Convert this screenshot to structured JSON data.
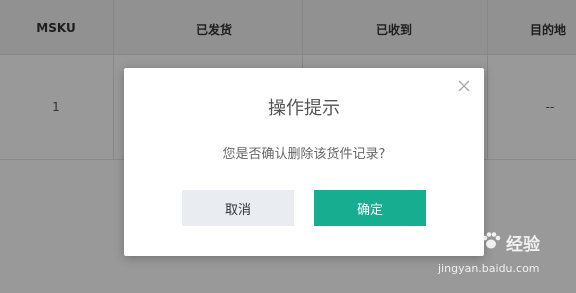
{
  "table": {
    "headers": [
      "MSKU",
      "已发货",
      "已收到",
      "目的地"
    ],
    "row": {
      "msku": "1",
      "destination": "--"
    }
  },
  "dialog": {
    "title": "操作提示",
    "message": "您是否确认删除该货件记录?",
    "cancel_label": "取消",
    "confirm_label": "确定",
    "close_icon": "close-icon"
  },
  "watermark": {
    "logo_text": "Bai",
    "brand": "经验",
    "url": "jingyan.baidu.com"
  },
  "colors": {
    "confirm": "#17ad90",
    "cancel": "#e9edf1",
    "overlay": "rgba(0,0,0,0.40)"
  }
}
